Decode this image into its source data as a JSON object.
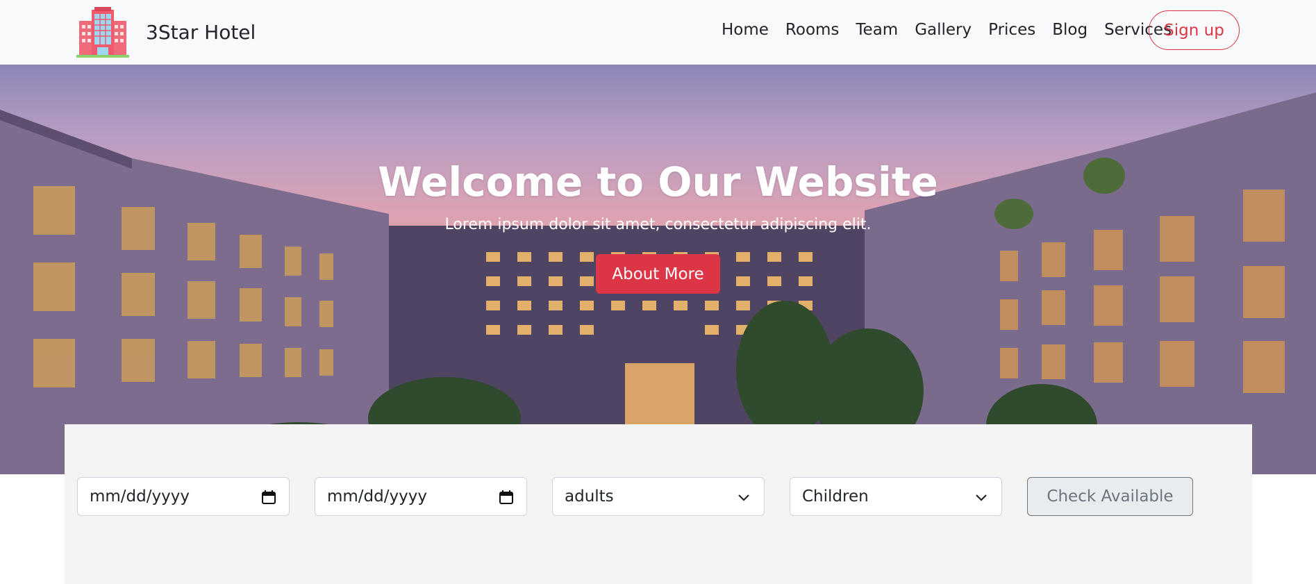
{
  "brand": {
    "name": "3Star Hotel",
    "logo_icon": "hotel-building-icon"
  },
  "nav": {
    "links": [
      "Home",
      "Rooms",
      "Team",
      "Gallery",
      "Prices",
      "Blog",
      "Services"
    ],
    "signup_label": "Sign up"
  },
  "hero": {
    "title": "Welcome to Our Website",
    "subtitle": "Lorem ipsum dolor sit amet, consectetur adipiscing elit.",
    "button_label": "About More"
  },
  "booking": {
    "checkin_value": "mm/dd/yyyy",
    "checkout_value": "mm/dd/yyyy",
    "adults_value": "adults",
    "children_value": "Children",
    "check_label": "Check Available"
  },
  "colors": {
    "accent": "#dc3545",
    "navbar_bg": "#f8f9fa",
    "panel_bg": "#f4f4f4"
  }
}
